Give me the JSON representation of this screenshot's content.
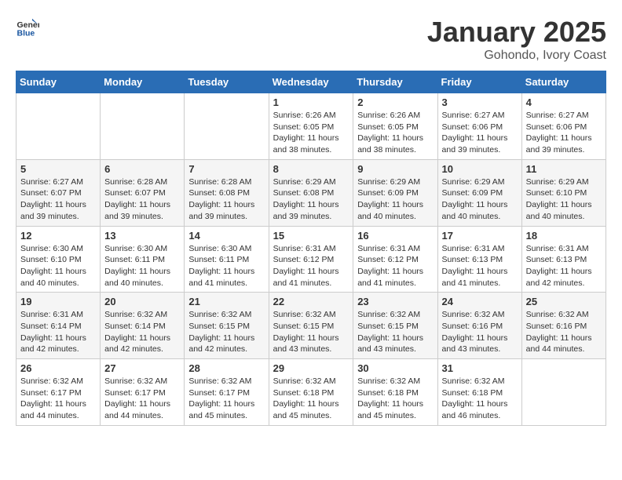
{
  "logo": {
    "general": "General",
    "blue": "Blue"
  },
  "header": {
    "month": "January 2025",
    "location": "Gohondo, Ivory Coast"
  },
  "weekdays": [
    "Sunday",
    "Monday",
    "Tuesday",
    "Wednesday",
    "Thursday",
    "Friday",
    "Saturday"
  ],
  "weeks": [
    [
      {
        "day": "",
        "sunrise": "",
        "sunset": "",
        "daylight": ""
      },
      {
        "day": "",
        "sunrise": "",
        "sunset": "",
        "daylight": ""
      },
      {
        "day": "",
        "sunrise": "",
        "sunset": "",
        "daylight": ""
      },
      {
        "day": "1",
        "sunrise": "Sunrise: 6:26 AM",
        "sunset": "Sunset: 6:05 PM",
        "daylight": "Daylight: 11 hours and 38 minutes."
      },
      {
        "day": "2",
        "sunrise": "Sunrise: 6:26 AM",
        "sunset": "Sunset: 6:05 PM",
        "daylight": "Daylight: 11 hours and 38 minutes."
      },
      {
        "day": "3",
        "sunrise": "Sunrise: 6:27 AM",
        "sunset": "Sunset: 6:06 PM",
        "daylight": "Daylight: 11 hours and 39 minutes."
      },
      {
        "day": "4",
        "sunrise": "Sunrise: 6:27 AM",
        "sunset": "Sunset: 6:06 PM",
        "daylight": "Daylight: 11 hours and 39 minutes."
      }
    ],
    [
      {
        "day": "5",
        "sunrise": "Sunrise: 6:27 AM",
        "sunset": "Sunset: 6:07 PM",
        "daylight": "Daylight: 11 hours and 39 minutes."
      },
      {
        "day": "6",
        "sunrise": "Sunrise: 6:28 AM",
        "sunset": "Sunset: 6:07 PM",
        "daylight": "Daylight: 11 hours and 39 minutes."
      },
      {
        "day": "7",
        "sunrise": "Sunrise: 6:28 AM",
        "sunset": "Sunset: 6:08 PM",
        "daylight": "Daylight: 11 hours and 39 minutes."
      },
      {
        "day": "8",
        "sunrise": "Sunrise: 6:29 AM",
        "sunset": "Sunset: 6:08 PM",
        "daylight": "Daylight: 11 hours and 39 minutes."
      },
      {
        "day": "9",
        "sunrise": "Sunrise: 6:29 AM",
        "sunset": "Sunset: 6:09 PM",
        "daylight": "Daylight: 11 hours and 40 minutes."
      },
      {
        "day": "10",
        "sunrise": "Sunrise: 6:29 AM",
        "sunset": "Sunset: 6:09 PM",
        "daylight": "Daylight: 11 hours and 40 minutes."
      },
      {
        "day": "11",
        "sunrise": "Sunrise: 6:29 AM",
        "sunset": "Sunset: 6:10 PM",
        "daylight": "Daylight: 11 hours and 40 minutes."
      }
    ],
    [
      {
        "day": "12",
        "sunrise": "Sunrise: 6:30 AM",
        "sunset": "Sunset: 6:10 PM",
        "daylight": "Daylight: 11 hours and 40 minutes."
      },
      {
        "day": "13",
        "sunrise": "Sunrise: 6:30 AM",
        "sunset": "Sunset: 6:11 PM",
        "daylight": "Daylight: 11 hours and 40 minutes."
      },
      {
        "day": "14",
        "sunrise": "Sunrise: 6:30 AM",
        "sunset": "Sunset: 6:11 PM",
        "daylight": "Daylight: 11 hours and 41 minutes."
      },
      {
        "day": "15",
        "sunrise": "Sunrise: 6:31 AM",
        "sunset": "Sunset: 6:12 PM",
        "daylight": "Daylight: 11 hours and 41 minutes."
      },
      {
        "day": "16",
        "sunrise": "Sunrise: 6:31 AM",
        "sunset": "Sunset: 6:12 PM",
        "daylight": "Daylight: 11 hours and 41 minutes."
      },
      {
        "day": "17",
        "sunrise": "Sunrise: 6:31 AM",
        "sunset": "Sunset: 6:13 PM",
        "daylight": "Daylight: 11 hours and 41 minutes."
      },
      {
        "day": "18",
        "sunrise": "Sunrise: 6:31 AM",
        "sunset": "Sunset: 6:13 PM",
        "daylight": "Daylight: 11 hours and 42 minutes."
      }
    ],
    [
      {
        "day": "19",
        "sunrise": "Sunrise: 6:31 AM",
        "sunset": "Sunset: 6:14 PM",
        "daylight": "Daylight: 11 hours and 42 minutes."
      },
      {
        "day": "20",
        "sunrise": "Sunrise: 6:32 AM",
        "sunset": "Sunset: 6:14 PM",
        "daylight": "Daylight: 11 hours and 42 minutes."
      },
      {
        "day": "21",
        "sunrise": "Sunrise: 6:32 AM",
        "sunset": "Sunset: 6:15 PM",
        "daylight": "Daylight: 11 hours and 42 minutes."
      },
      {
        "day": "22",
        "sunrise": "Sunrise: 6:32 AM",
        "sunset": "Sunset: 6:15 PM",
        "daylight": "Daylight: 11 hours and 43 minutes."
      },
      {
        "day": "23",
        "sunrise": "Sunrise: 6:32 AM",
        "sunset": "Sunset: 6:15 PM",
        "daylight": "Daylight: 11 hours and 43 minutes."
      },
      {
        "day": "24",
        "sunrise": "Sunrise: 6:32 AM",
        "sunset": "Sunset: 6:16 PM",
        "daylight": "Daylight: 11 hours and 43 minutes."
      },
      {
        "day": "25",
        "sunrise": "Sunrise: 6:32 AM",
        "sunset": "Sunset: 6:16 PM",
        "daylight": "Daylight: 11 hours and 44 minutes."
      }
    ],
    [
      {
        "day": "26",
        "sunrise": "Sunrise: 6:32 AM",
        "sunset": "Sunset: 6:17 PM",
        "daylight": "Daylight: 11 hours and 44 minutes."
      },
      {
        "day": "27",
        "sunrise": "Sunrise: 6:32 AM",
        "sunset": "Sunset: 6:17 PM",
        "daylight": "Daylight: 11 hours and 44 minutes."
      },
      {
        "day": "28",
        "sunrise": "Sunrise: 6:32 AM",
        "sunset": "Sunset: 6:17 PM",
        "daylight": "Daylight: 11 hours and 45 minutes."
      },
      {
        "day": "29",
        "sunrise": "Sunrise: 6:32 AM",
        "sunset": "Sunset: 6:18 PM",
        "daylight": "Daylight: 11 hours and 45 minutes."
      },
      {
        "day": "30",
        "sunrise": "Sunrise: 6:32 AM",
        "sunset": "Sunset: 6:18 PM",
        "daylight": "Daylight: 11 hours and 45 minutes."
      },
      {
        "day": "31",
        "sunrise": "Sunrise: 6:32 AM",
        "sunset": "Sunset: 6:18 PM",
        "daylight": "Daylight: 11 hours and 46 minutes."
      },
      {
        "day": "",
        "sunrise": "",
        "sunset": "",
        "daylight": ""
      }
    ]
  ]
}
